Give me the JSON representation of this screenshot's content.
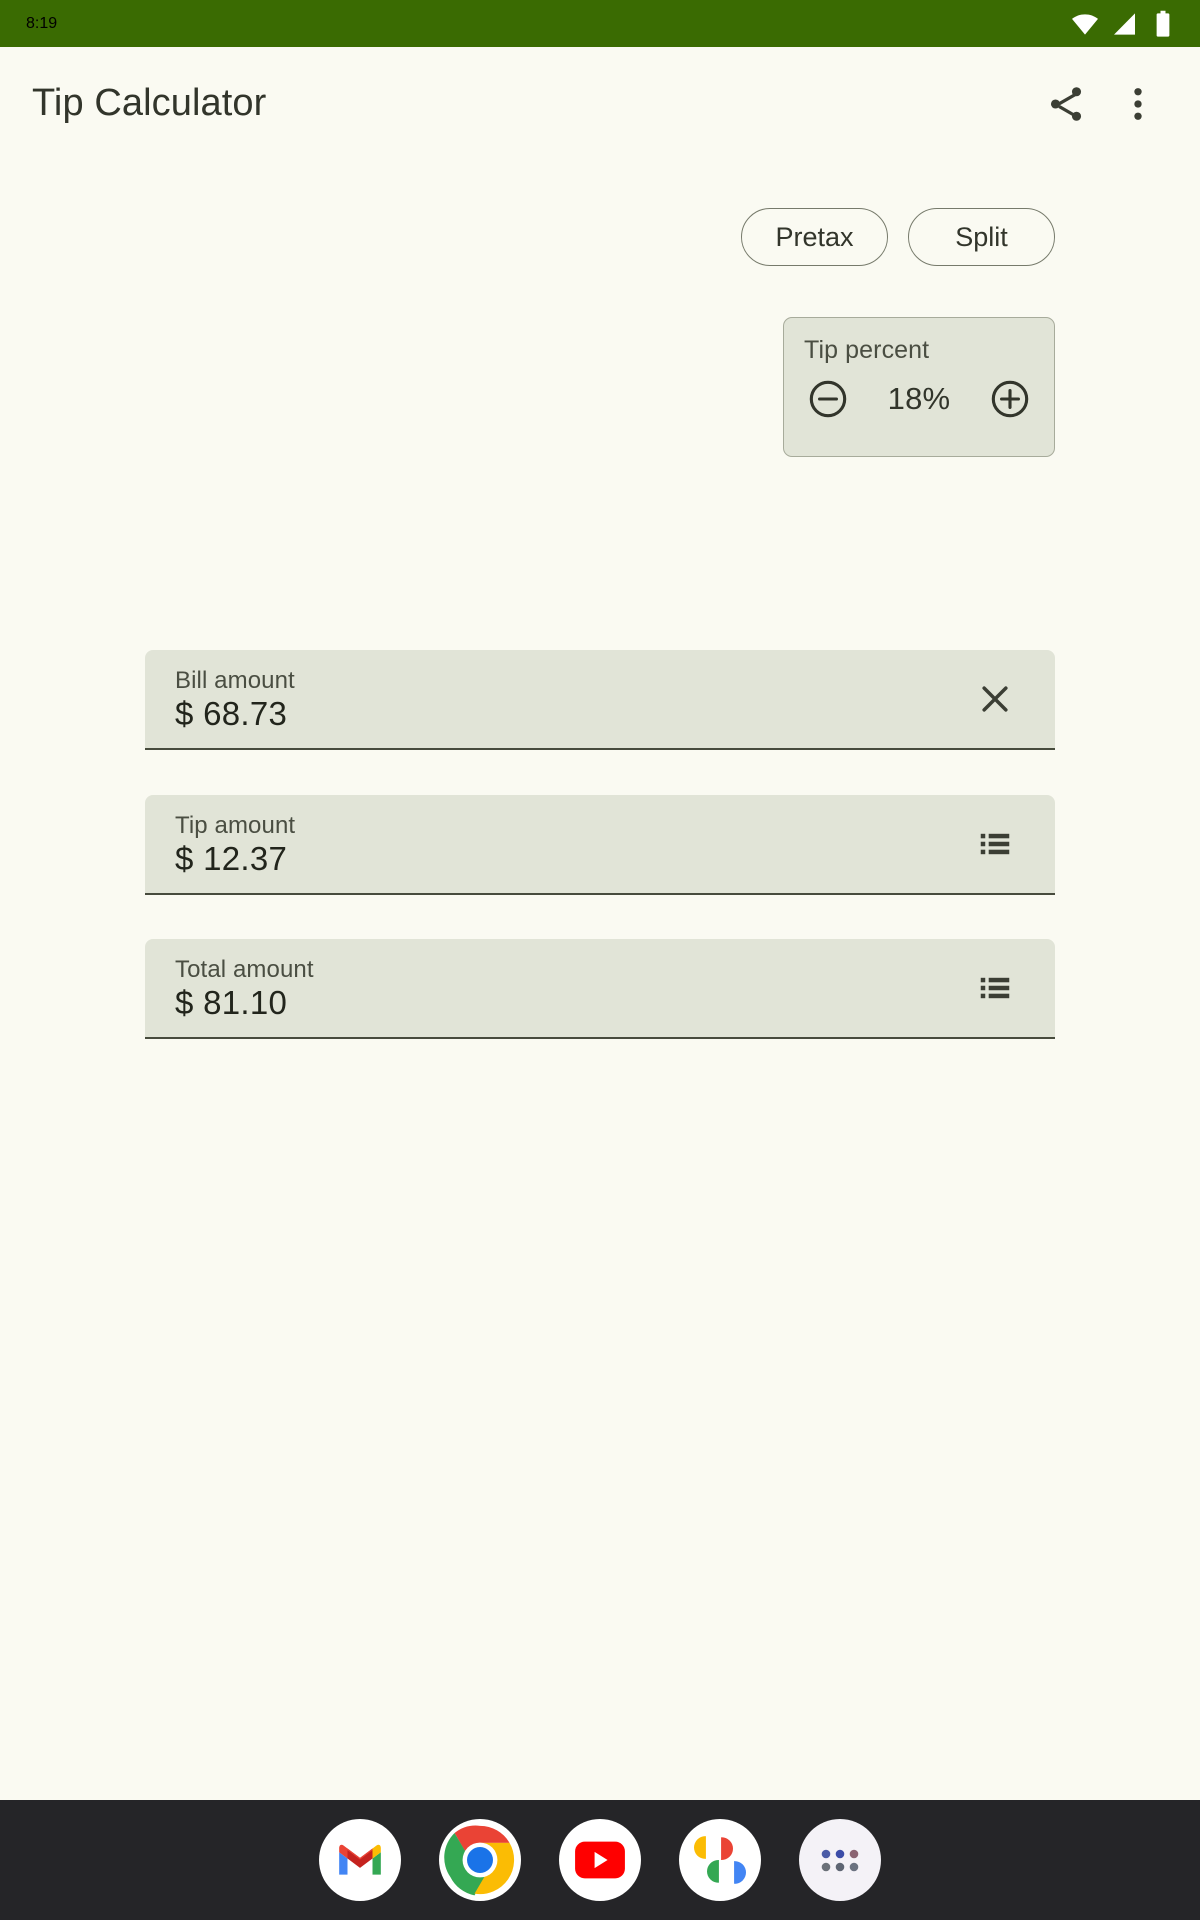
{
  "status_bar": {
    "clock": "8:19",
    "background_color": "#3A6B02",
    "icons": [
      "wifi-icon",
      "cellular-signal-icon",
      "battery-icon"
    ]
  },
  "app_bar": {
    "title": "Tip Calculator",
    "share_icon": "share-icon",
    "overflow_icon": "overflow-menu-icon"
  },
  "toggles": [
    {
      "label": "Pretax"
    },
    {
      "label": "Split"
    }
  ],
  "tip_percent": {
    "label": "Tip percent",
    "value": "18%",
    "decrease_icon": "minus-circle-icon",
    "increase_icon": "plus-circle-icon"
  },
  "fields": [
    {
      "label": "Bill amount",
      "value": "$ 68.73",
      "action_icon": "close-icon"
    },
    {
      "label": "Tip amount",
      "value": "$ 12.37",
      "action_icon": "list-icon"
    },
    {
      "label": "Total amount",
      "value": "$ 81.10",
      "action_icon": "list-icon"
    }
  ],
  "dock": {
    "background_color": "#252528",
    "items": [
      {
        "name": "gmail-icon"
      },
      {
        "name": "chrome-icon"
      },
      {
        "name": "youtube-icon"
      },
      {
        "name": "google-photos-icon"
      },
      {
        "name": "app-drawer-icon"
      }
    ]
  },
  "theme": {
    "page_background": "#FAFAF2",
    "field_background": "#E1E4D7",
    "accent_green": "#3A6B02",
    "text_primary": "#22251C",
    "text_secondary": "#4A4E42"
  }
}
